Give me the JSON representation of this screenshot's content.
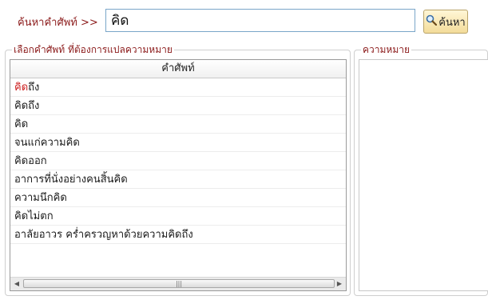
{
  "search": {
    "label": "ค้นหาคำศัพท์ >>",
    "value": "คิด",
    "button_label": "ค้นหา",
    "button_icon": "magnifier-icon"
  },
  "word_panel": {
    "legend": "เลือกคำศัพท์ ที่ต้องการแปลความหมาย",
    "column_header": "คำศัพท์",
    "rows": [
      {
        "highlight": "คิด",
        "rest": "ถึง"
      },
      {
        "highlight": "",
        "rest": "คิดถึง"
      },
      {
        "highlight": "",
        "rest": "คิด"
      },
      {
        "highlight": "",
        "rest": "จนแก่ความคิด"
      },
      {
        "highlight": "",
        "rest": "คิดออก"
      },
      {
        "highlight": "",
        "rest": "อาการที่นั่งอย่างคนสิ้นคิด"
      },
      {
        "highlight": "",
        "rest": "ความนึกคิด"
      },
      {
        "highlight": "",
        "rest": "คิดไม่ตก"
      },
      {
        "highlight": "",
        "rest": "อาลัยอาวร คร่ำครวญหาด้วยความคิดถึง"
      }
    ],
    "scroll_left": "◀",
    "scroll_right": "▶",
    "scroll_thumb_grip": "|||"
  },
  "meaning_panel": {
    "legend": "ความหมาย"
  },
  "colors": {
    "legend_text": "#8b1a1a",
    "highlight": "#cc2020",
    "input_border": "#7aa6c9"
  }
}
